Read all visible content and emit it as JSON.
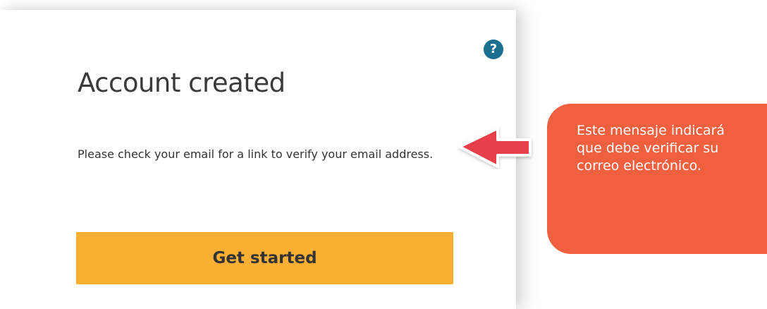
{
  "dialog": {
    "help_glyph": "?",
    "title": "Account created",
    "message": "Please check your email for a link to verify your email address.",
    "button_label": "Get started"
  },
  "annotation": {
    "text": "Este mensaje indicará que debe verificar su correo electrónico.",
    "color": "#f0603f",
    "arrow_color": "#e8414a"
  },
  "colors": {
    "button": "#fbb034",
    "help_icon": "#1b6f8e"
  },
  "icons": {
    "help": "question-circle-icon",
    "pointer": "left-arrow-icon"
  }
}
